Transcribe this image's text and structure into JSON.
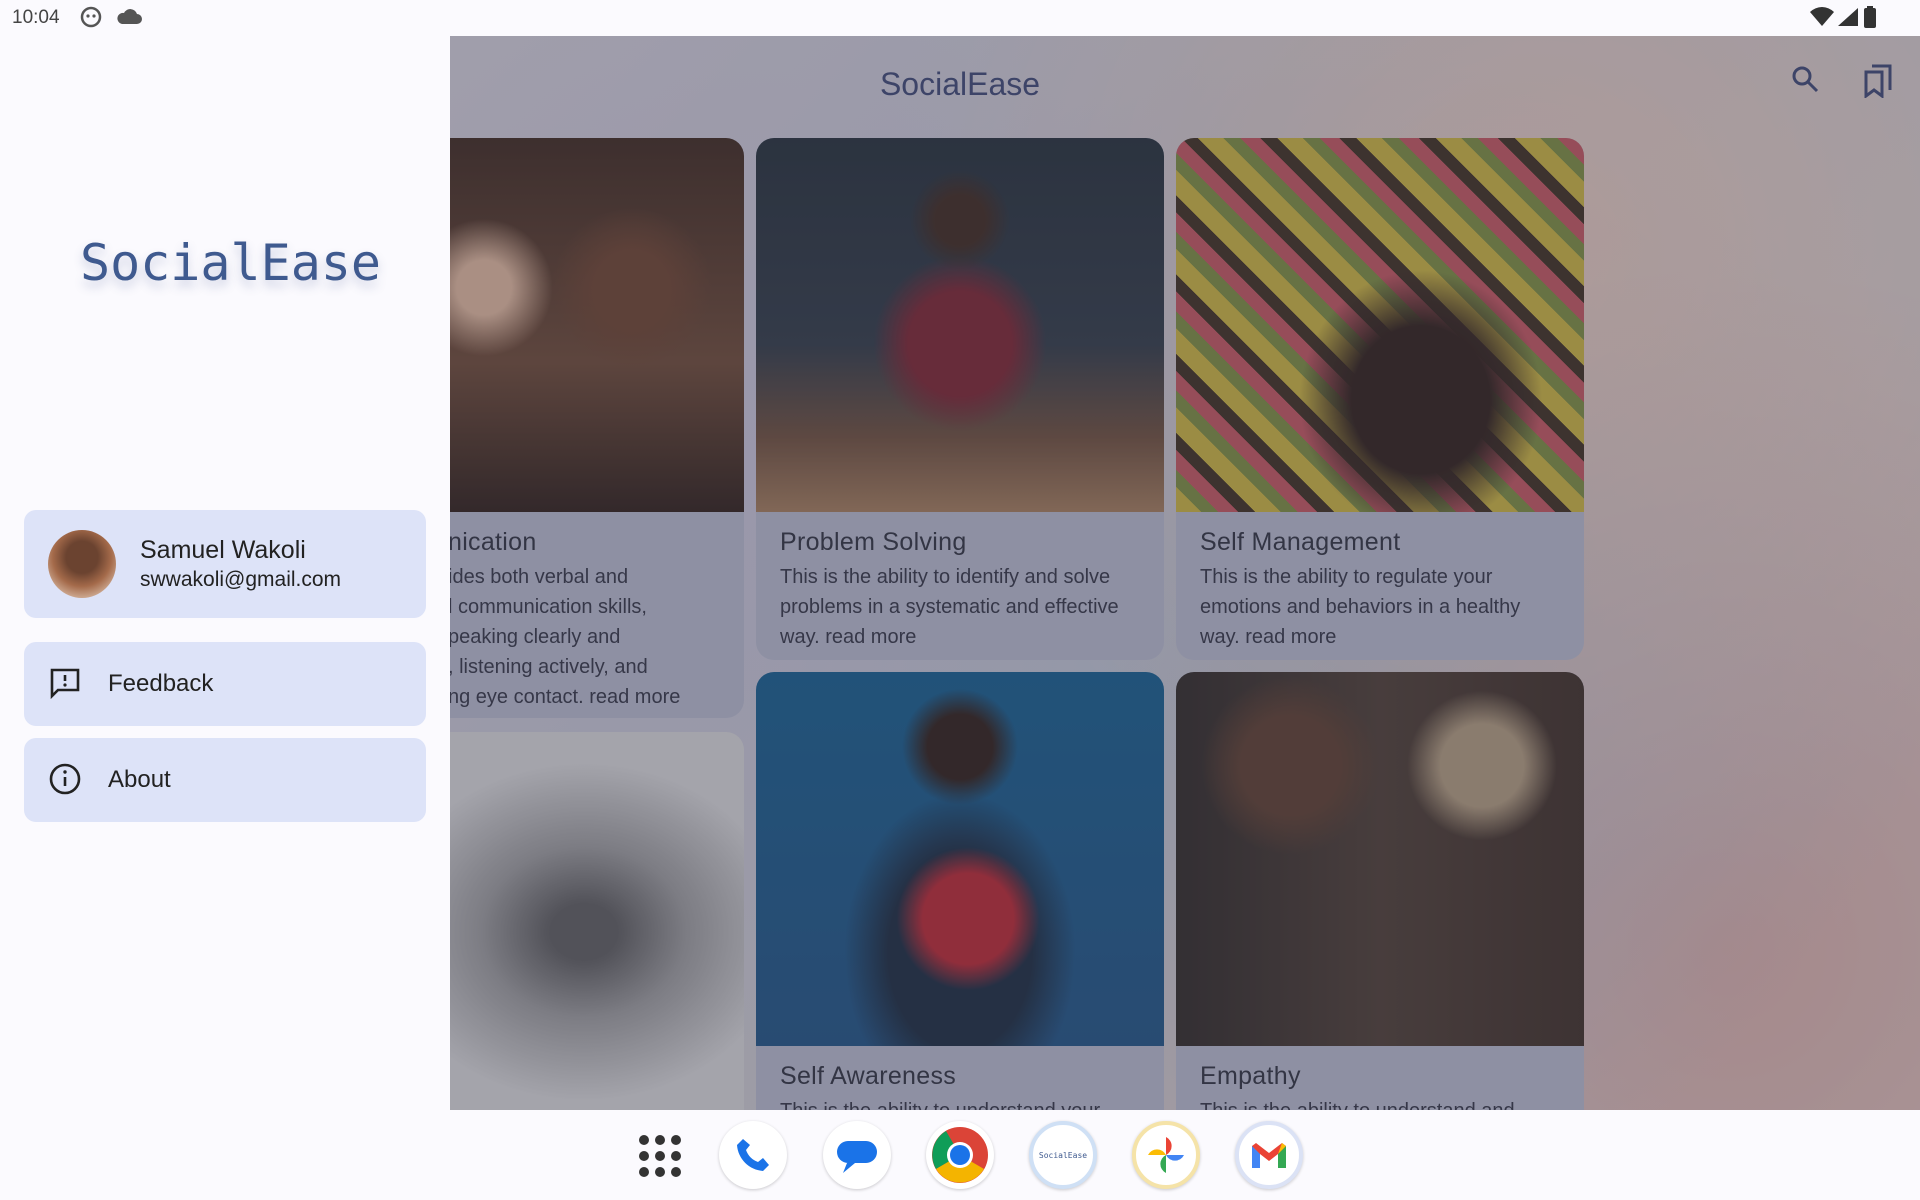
{
  "status_bar": {
    "time": "10:04",
    "icons": [
      "android-icon",
      "cloud-icon",
      "wifi-icon",
      "signal-icon",
      "battery-icon"
    ]
  },
  "app_bar": {
    "title": "SocialEase",
    "icons": [
      "search-icon",
      "bookmarks-icon"
    ]
  },
  "cards": [
    {
      "title": "nication",
      "description": "ides both verbal and\nl communication skills,\npeaking clearly and\n, listening actively, and\nng eye contact.",
      "read_more": "read more"
    },
    {
      "title": "Problem Solving",
      "description": "This is the ability to identify and solve problems in a systematic and effective way.",
      "read_more": "read more"
    },
    {
      "title": "Self Management",
      "description": "This is the ability to regulate your emotions and behaviors in a healthy way.",
      "read_more": "read more"
    },
    {
      "title": "Self Awareness",
      "description": "This is the ability to understand your",
      "read_more": ""
    },
    {
      "title": "Empathy",
      "description": "This is the ability to understand and",
      "read_more": ""
    }
  ],
  "drawer": {
    "logo": "SocialEase",
    "user": {
      "name": "Samuel Wakoli",
      "email": "swwakoli@gmail.com"
    },
    "menu": [
      {
        "label": "Feedback",
        "icon": "feedback-icon"
      },
      {
        "label": "About",
        "icon": "info-icon"
      }
    ]
  },
  "taskbar": {
    "apps": [
      "all-apps-icon",
      "phone-icon",
      "messages-icon",
      "chrome-icon",
      "socialease-icon",
      "photos-icon",
      "gmail-icon"
    ],
    "socialease_label": "SocialEase"
  },
  "colors": {
    "accent": "#3f5a8f",
    "drawer_item_bg": "#dde3f8",
    "card_bg": "#b5b9cb"
  }
}
